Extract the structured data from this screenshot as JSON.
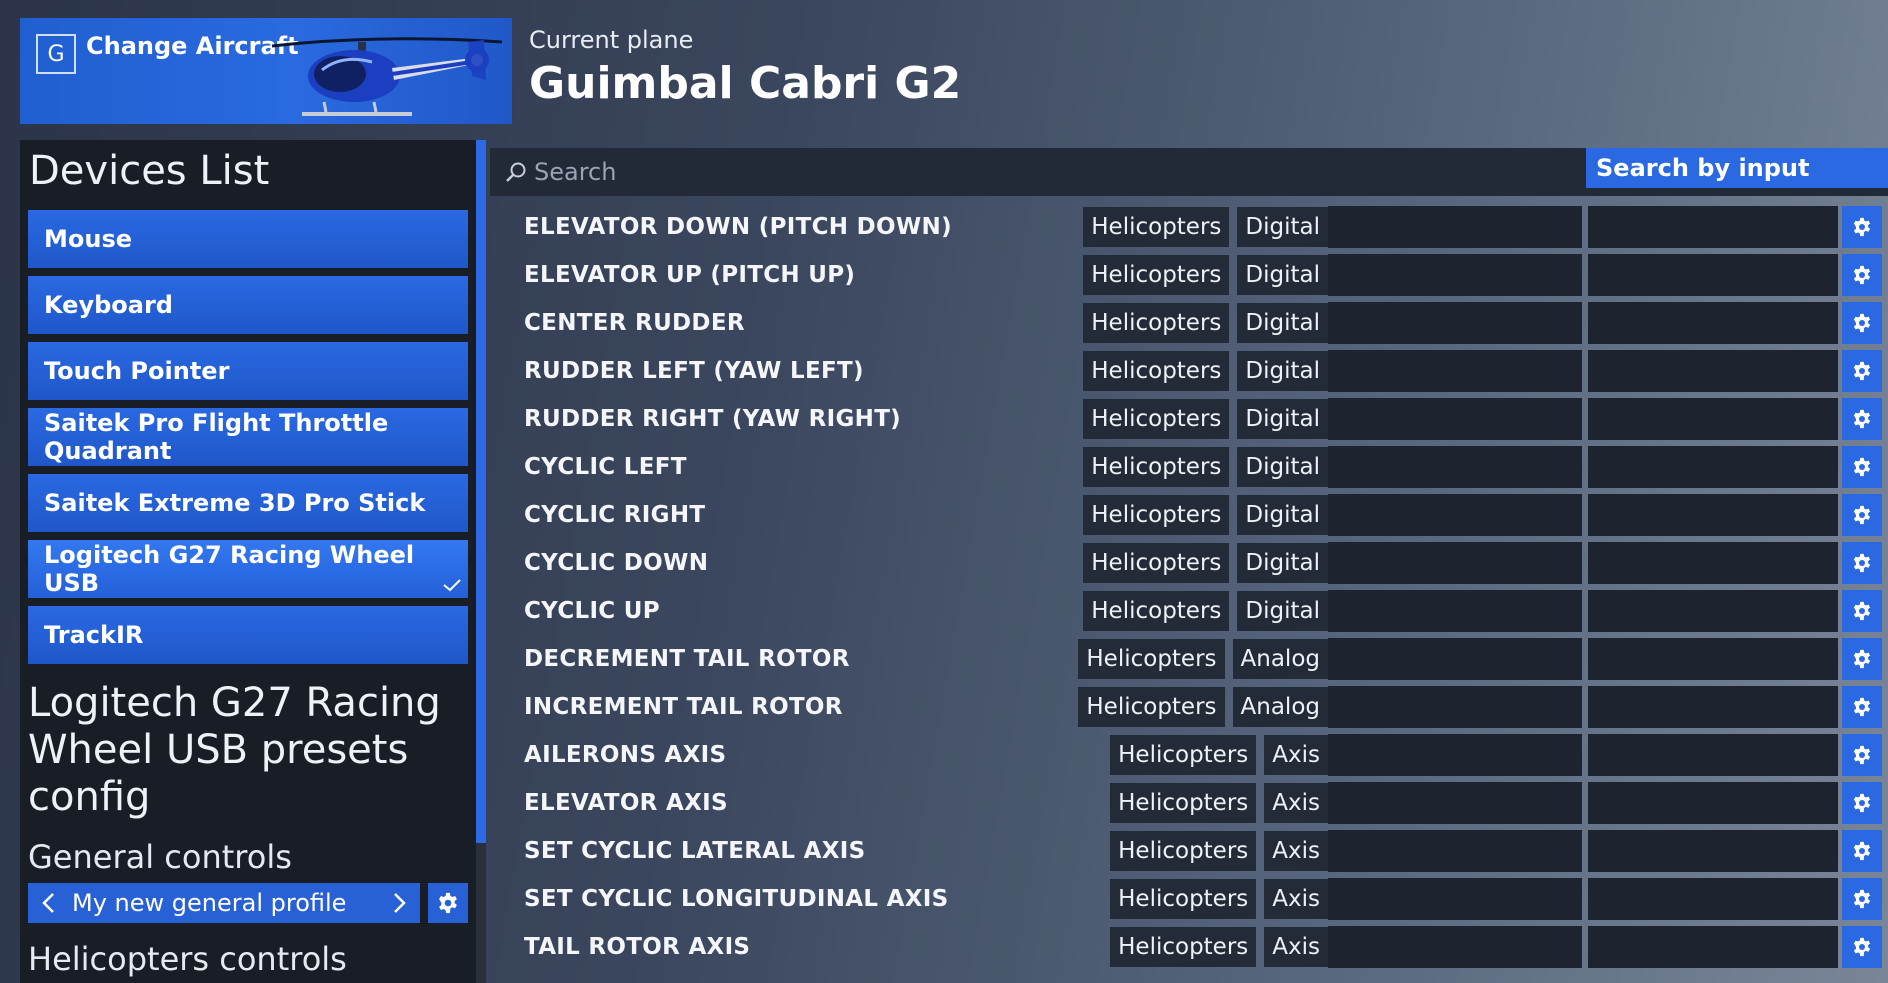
{
  "header": {
    "key_hint": "G",
    "change_aircraft_label": "Change Aircraft",
    "current_plane_caption": "Current plane",
    "plane_name": "Guimbal Cabri G2"
  },
  "sidebar": {
    "title": "Devices List",
    "devices": [
      {
        "label": "Mouse",
        "selected": false
      },
      {
        "label": "Keyboard",
        "selected": false
      },
      {
        "label": "Touch Pointer",
        "selected": false
      },
      {
        "label": "Saitek Pro Flight Throttle Quadrant",
        "selected": false
      },
      {
        "label": "Saitek Extreme 3D Pro Stick",
        "selected": false
      },
      {
        "label": "Logitech G27 Racing Wheel USB",
        "selected": true
      },
      {
        "label": "TrackIR",
        "selected": false
      }
    ],
    "presets_title": "Logitech G27 Racing Wheel USB presets config",
    "general_controls_title": "General controls",
    "general_profile": "My new general profile",
    "helicopters_controls_title": "Helicopters controls"
  },
  "search": {
    "placeholder": "Search",
    "value": "",
    "search_by_input_label": "Search by input"
  },
  "bindings": [
    {
      "name": "ELEVATOR DOWN (PITCH DOWN)",
      "category": "Helicopters",
      "type": "Digital"
    },
    {
      "name": "ELEVATOR UP (PITCH UP)",
      "category": "Helicopters",
      "type": "Digital"
    },
    {
      "name": "CENTER RUDDER",
      "category": "Helicopters",
      "type": "Digital"
    },
    {
      "name": "RUDDER LEFT (YAW LEFT)",
      "category": "Helicopters",
      "type": "Digital"
    },
    {
      "name": "RUDDER RIGHT (YAW RIGHT)",
      "category": "Helicopters",
      "type": "Digital"
    },
    {
      "name": "CYCLIC LEFT",
      "category": "Helicopters",
      "type": "Digital"
    },
    {
      "name": "CYCLIC RIGHT",
      "category": "Helicopters",
      "type": "Digital"
    },
    {
      "name": "CYCLIC DOWN",
      "category": "Helicopters",
      "type": "Digital"
    },
    {
      "name": "CYCLIC UP",
      "category": "Helicopters",
      "type": "Digital"
    },
    {
      "name": "DECREMENT TAIL ROTOR",
      "category": "Helicopters",
      "type": "Analog"
    },
    {
      "name": "INCREMENT TAIL ROTOR",
      "category": "Helicopters",
      "type": "Analog"
    },
    {
      "name": "AILERONS AXIS",
      "category": "Helicopters",
      "type": "Axis"
    },
    {
      "name": "ELEVATOR AXIS",
      "category": "Helicopters",
      "type": "Axis"
    },
    {
      "name": "SET CYCLIC LATERAL AXIS",
      "category": "Helicopters",
      "type": "Axis"
    },
    {
      "name": "SET CYCLIC LONGITUDINAL AXIS",
      "category": "Helicopters",
      "type": "Axis"
    },
    {
      "name": "TAIL ROTOR AXIS",
      "category": "Helicopters",
      "type": "Axis"
    }
  ],
  "icons": {
    "search": "search-icon",
    "gear": "gear-icon",
    "check": "check-icon",
    "chevron_left": "chevron-left-icon",
    "chevron_right": "chevron-right-icon",
    "helicopter": "helicopter-image"
  },
  "colors": {
    "accent": "#2a69e2",
    "sidebar_bg": "#181d26",
    "slot_bg": "#1d2430",
    "tag_bg": "#242b38"
  }
}
